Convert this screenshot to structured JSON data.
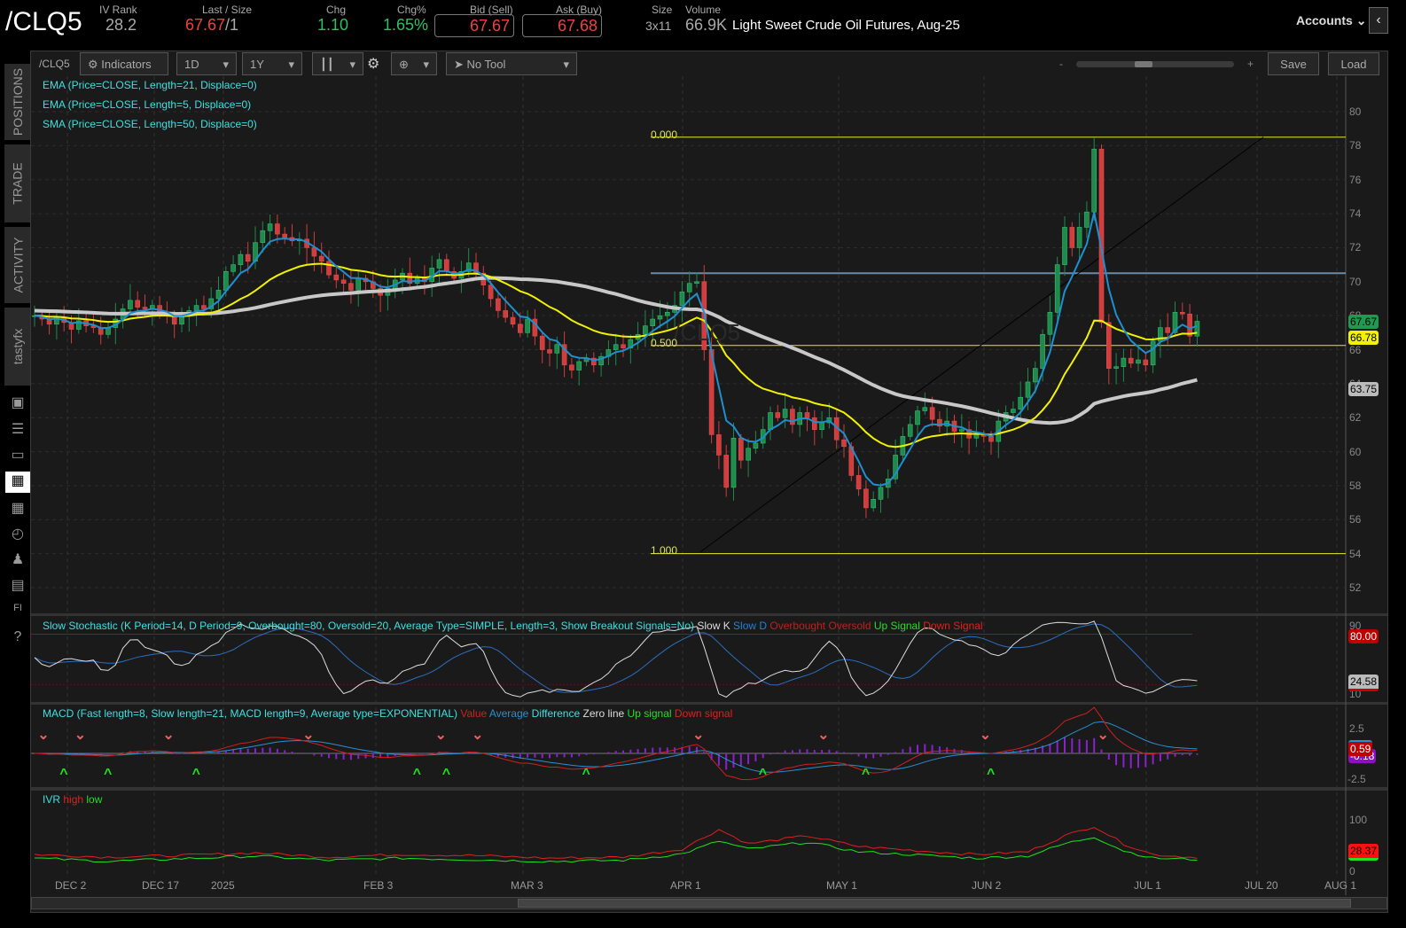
{
  "header": {
    "symbol": "/CLQ5",
    "iv_rank_label": "IV Rank",
    "iv_rank": "28.2",
    "last_size_label": "Last / Size",
    "last": "67.67",
    "size": "/1",
    "chg_label": "Chg",
    "chg": "1.10",
    "chg_pct_label": "Chg%",
    "chg_pct": "1.65%",
    "bid_label": "Bid (Sell)",
    "bid": "67.67",
    "ask_label": "Ask (Buy)",
    "ask": "67.68",
    "size_label": "Size",
    "size_val": "3x11",
    "volume_label": "Volume",
    "volume": "66.9K",
    "description": "Light Sweet Crude Oil Futures, Aug-25",
    "accounts": "Accounts"
  },
  "sidebar": {
    "tabs": [
      "POSITIONS",
      "TRADE",
      "ACTIVITY",
      "tastyfx"
    ]
  },
  "toolbar": {
    "symbol": "/CLQ5",
    "indicators": "Indicators",
    "aggregation": "1D",
    "range": "1Y",
    "drawing_tool": "No Tool",
    "zoom_minus": "-",
    "zoom_plus": "+",
    "save": "Save",
    "load": "Load",
    "zoom_level": 0.42
  },
  "studies": [
    "EMA (Price=CLOSE, Length=21, Displace=0)",
    "EMA (Price=CLOSE, Length=5, Displace=0)",
    "SMA (Price=CLOSE, Length=50, Displace=0)"
  ],
  "watermark": "/CLQ5",
  "colors": {
    "up": "#1f8a4c",
    "down": "#d23c3c",
    "ema21": "#f2f200",
    "ema5": "#1e8fd0",
    "sma50": "#c8c8c8"
  },
  "fib": {
    "labels": [
      "0.000",
      "0.500",
      "1.000"
    ],
    "high": 78.5,
    "low": 54.0,
    "resistance": 70.5
  },
  "price_axis": {
    "ticks": [
      "80",
      "78",
      "76",
      "74",
      "72",
      "70",
      "68",
      "66",
      "64",
      "62",
      "60",
      "58",
      "56",
      "54",
      "52"
    ],
    "badges": {
      "last": "67.67",
      "ema21": "66.78",
      "sma50": "63.75"
    }
  },
  "x_axis": {
    "labels": [
      "DEC 2",
      "DEC 17",
      "2025",
      "FEB 3",
      "MAR 3",
      "APR 1",
      "MAY 1",
      "JUN 2",
      "JUL 1",
      "JUL 20",
      "AUG 1"
    ]
  },
  "stochastic": {
    "title": "Slow Stochastic (K Period=14, D Period=9, Overbought=80, Oversold=20, Average Type=SIMPLE, Length=3, Show Breakout Signals=No)",
    "legend": [
      "Slow K",
      "Slow D",
      "Overbought",
      "Oversold",
      "Up Signal",
      "Down Signal"
    ],
    "ticks": [
      "90",
      "10"
    ],
    "badges": [
      "80.00",
      "24.58"
    ]
  },
  "macd": {
    "title": "MACD (Fast length=8, Slow length=21, MACD length=9, Average type=EXPONENTIAL)",
    "legend": [
      "Value",
      "Average",
      "Difference",
      "Zero line",
      "Up signal",
      "Down signal"
    ],
    "ticks": [
      "2.5",
      "-2.5"
    ],
    "badges": [
      "0.59",
      "-0.18"
    ],
    "down_signals": [
      1,
      6,
      18,
      37,
      55,
      60,
      90,
      107,
      129,
      145
    ],
    "up_signals": [
      4,
      10,
      22,
      52,
      56,
      75,
      99,
      113,
      130
    ]
  },
  "ivr": {
    "title": "IVR",
    "legend": [
      "high",
      "low"
    ],
    "ticks": [
      "100",
      "0"
    ],
    "badge": "28.37",
    "high": [
      [
        0,
        35
      ],
      [
        10,
        30
      ],
      [
        20,
        33
      ],
      [
        30,
        38
      ],
      [
        40,
        30
      ],
      [
        50,
        35
      ],
      [
        60,
        33
      ],
      [
        70,
        28
      ],
      [
        80,
        30
      ],
      [
        88,
        45
      ],
      [
        93,
        82
      ],
      [
        97,
        55
      ],
      [
        105,
        70
      ],
      [
        112,
        50
      ],
      [
        120,
        42
      ],
      [
        128,
        35
      ],
      [
        135,
        40
      ],
      [
        140,
        70
      ],
      [
        144,
        88
      ],
      [
        148,
        55
      ],
      [
        152,
        35
      ],
      [
        157,
        30
      ]
    ],
    "low": [
      [
        0,
        28
      ],
      [
        10,
        22
      ],
      [
        20,
        27
      ],
      [
        30,
        32
      ],
      [
        40,
        24
      ],
      [
        50,
        28
      ],
      [
        60,
        25
      ],
      [
        70,
        22
      ],
      [
        80,
        24
      ],
      [
        88,
        36
      ],
      [
        93,
        60
      ],
      [
        97,
        45
      ],
      [
        105,
        58
      ],
      [
        112,
        40
      ],
      [
        120,
        34
      ],
      [
        128,
        28
      ],
      [
        135,
        32
      ],
      [
        140,
        55
      ],
      [
        144,
        68
      ],
      [
        148,
        42
      ],
      [
        152,
        28
      ],
      [
        157,
        26
      ]
    ]
  },
  "chart_data": {
    "type": "candlestick",
    "title": "/CLQ5 1D 1Y",
    "ylim": [
      51,
      81
    ],
    "closes": [
      68.0,
      67.8,
      67.5,
      67.9,
      67.6,
      67.2,
      67.7,
      67.4,
      67.3,
      66.9,
      67.3,
      67.8,
      68.4,
      68.9,
      68.5,
      68.4,
      68.6,
      68.2,
      68.0,
      67.5,
      68.0,
      68.3,
      68.6,
      68.4,
      69.0,
      69.5,
      70.6,
      71.0,
      71.6,
      71.2,
      72.3,
      73.0,
      73.4,
      72.8,
      72.6,
      72.4,
      72.5,
      72.0,
      71.5,
      71.2,
      70.4,
      70.1,
      69.9,
      69.5,
      70.2,
      70.0,
      69.6,
      69.2,
      69.6,
      70.1,
      70.5,
      69.9,
      70.2,
      70.0,
      70.8,
      71.3,
      70.6,
      70.2,
      70.6,
      71.1,
      70.5,
      69.8,
      69.0,
      68.3,
      67.9,
      67.5,
      67.0,
      67.8,
      66.8,
      66.0,
      65.8,
      66.3,
      65.1,
      64.8,
      65.3,
      65.5,
      65.1,
      65.6,
      66.0,
      66.3,
      66.1,
      66.6,
      66.9,
      67.4,
      67.8,
      68.0,
      68.2,
      68.6,
      69.4,
      69.9,
      70.0,
      66.0,
      61.0,
      59.8,
      57.9,
      60.8,
      59.5,
      60.2,
      60.5,
      61.3,
      62.3,
      62.0,
      62.5,
      61.6,
      62.3,
      62.0,
      61.3,
      61.7,
      62.0,
      60.7,
      60.3,
      58.6,
      57.8,
      56.7,
      57.2,
      57.9,
      58.4,
      59.8,
      60.9,
      61.6,
      62.4,
      62.6,
      61.9,
      61.5,
      61.8,
      61.2,
      61.3,
      60.8,
      61.0,
      60.9,
      60.6,
      61.8,
      62.3,
      62.5,
      63.2,
      64.1,
      64.9,
      66.9,
      68.2,
      71.0,
      73.2,
      72.0,
      73.2,
      74.1,
      77.8,
      67.6,
      64.9,
      65.0,
      65.5,
      65.2,
      65.4,
      65.1,
      66.5,
      67.3,
      67.0,
      68.2,
      68.1,
      66.8,
      67.67
    ]
  }
}
